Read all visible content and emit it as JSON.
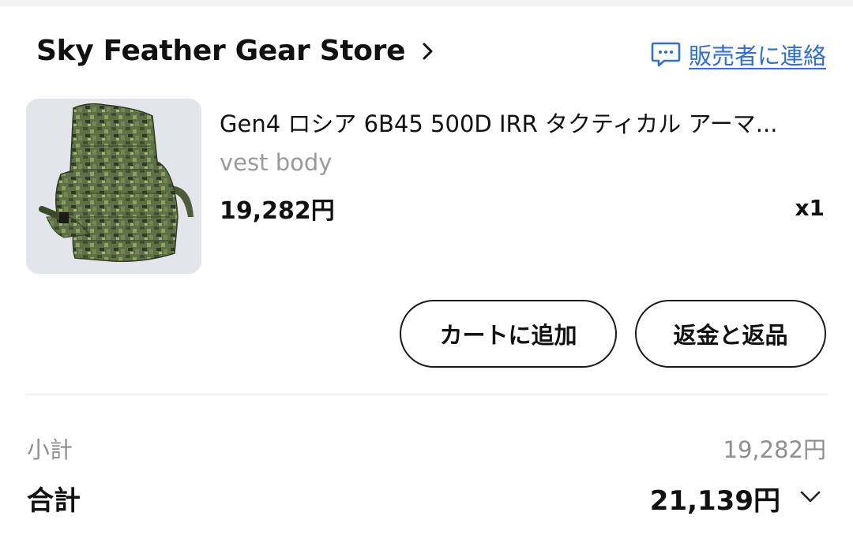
{
  "store": {
    "name": "Sky Feather Gear Store",
    "contact_label": "販売者に連絡",
    "accent": "#2f6fd6"
  },
  "item": {
    "title": "Gen4 ロシア 6B45 500D IRR タクティカル アーマ...",
    "variant": "vest body",
    "price": "19,282円",
    "quantity": "x1",
    "image_icon": "camo-vest-image"
  },
  "actions": {
    "add_to_cart": "カートに追加",
    "refund_return": "返金と返品"
  },
  "summary": {
    "subtotal_label": "小計",
    "subtotal_value": "19,282円",
    "total_label": "合計",
    "total_value": "21,139円"
  }
}
